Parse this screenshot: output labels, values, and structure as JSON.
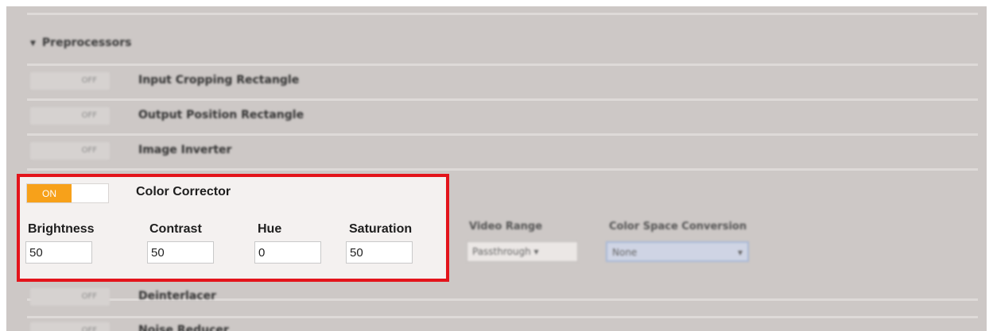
{
  "section": {
    "title": "Preprocessors",
    "expand_icon": "triangle-down-icon"
  },
  "toggle_off_label": "OFF",
  "toggle_on_label": "ON",
  "rows_above": [
    {
      "label": "Input Cropping Rectangle",
      "state": "OFF"
    },
    {
      "label": "Output Position Rectangle",
      "state": "OFF"
    },
    {
      "label": "Image Inverter",
      "state": "OFF"
    }
  ],
  "color_corrector": {
    "title": "Color Corrector",
    "state": "ON",
    "fields": {
      "brightness": {
        "label": "Brightness",
        "value": "50"
      },
      "contrast": {
        "label": "Contrast",
        "value": "50"
      },
      "hue": {
        "label": "Hue",
        "value": "0"
      },
      "saturation": {
        "label": "Saturation",
        "value": "50"
      }
    },
    "video_range": {
      "label": "Video Range",
      "value": "Passthrough"
    },
    "color_space_conversion": {
      "label": "Color Space Conversion",
      "value": "None"
    }
  },
  "rows_below": [
    {
      "label": "Deinterlacer",
      "state": "OFF"
    },
    {
      "label": "Noise Reducer",
      "state": "OFF"
    }
  ],
  "colors": {
    "highlight_border": "#e3141b",
    "toggle_on": "#f7a11a",
    "panel_bg": "#cdc8c6"
  }
}
